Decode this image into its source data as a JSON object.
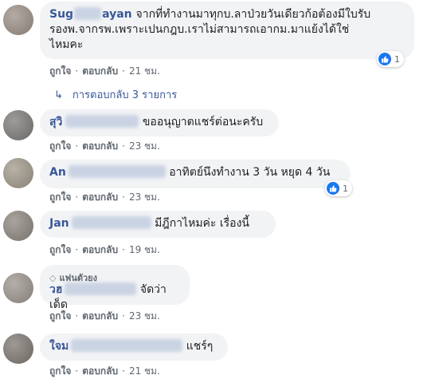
{
  "comments": [
    {
      "name_visible": "Sug",
      "name_visible_end": "ayan",
      "text": "จากที่ทำงานมาทุกบ.ลาป่วยวันเดียวก้อต้องมีใบรับรองพ.จากรพ.เพราะเปนกฎบ.เราไม่สามารถเอากม.มาแย้งได้ใช่ไหมคะ",
      "text_line1": "จากที่ทำงานมาทุกบ.ลาป่วยวันเดียวก้อต้องมีใบรับ",
      "text_line2": "รองพ.จากรพ.เพราะเปนกฎบ.เราไม่สามารถเอากม.มาแย้งได้ใช่",
      "text_line3": "ไหมคะ",
      "like_label": "ถูกใจ",
      "reply_label": "ตอบกลับ",
      "time": "21 ชม.",
      "reaction_count": "1"
    },
    {
      "name_visible": "สุวิ",
      "text": "ขออนุญาตแชร์ต่อนะครับ",
      "like_label": "ถูกใจ",
      "reply_label": "ตอบกลับ",
      "time": "23 ชม."
    },
    {
      "name_visible": "An",
      "text": "อาทิตย์นึงทำงาน 3 วัน หยุด 4 วัน",
      "like_label": "ถูกใจ",
      "reply_label": "ตอบกลับ",
      "time": "23 ชม.",
      "reaction_count": "1"
    },
    {
      "name_visible": "Jan",
      "text": "มีฎีกาไหมค่ะ เรื่องนี้",
      "like_label": "ถูกใจ",
      "reply_label": "ตอบกลับ",
      "time": "19 ชม."
    },
    {
      "badge": "แฟนตัวยง",
      "name_visible": "วฮ",
      "text": "จัดว่าเด็ด",
      "like_label": "ถูกใจ",
      "reply_label": "ตอบกลับ",
      "time": "23 ชม."
    },
    {
      "name_visible": "ใจม",
      "text": "แชร์ๆ",
      "like_label": "ถูกใจ",
      "reply_label": "ตอบกลับ",
      "time": "21 ชม."
    }
  ],
  "replies_link": "การตอบกลับ 3 รายการ",
  "colors": {
    "name": "#385898",
    "bubble": "#f2f3f5",
    "meta": "#606770",
    "like": "#1877f2"
  },
  "icons": {
    "reply_arrow": "reply-arrow-icon",
    "reaction": "like-reaction-icon",
    "badge": "diamond-icon"
  }
}
